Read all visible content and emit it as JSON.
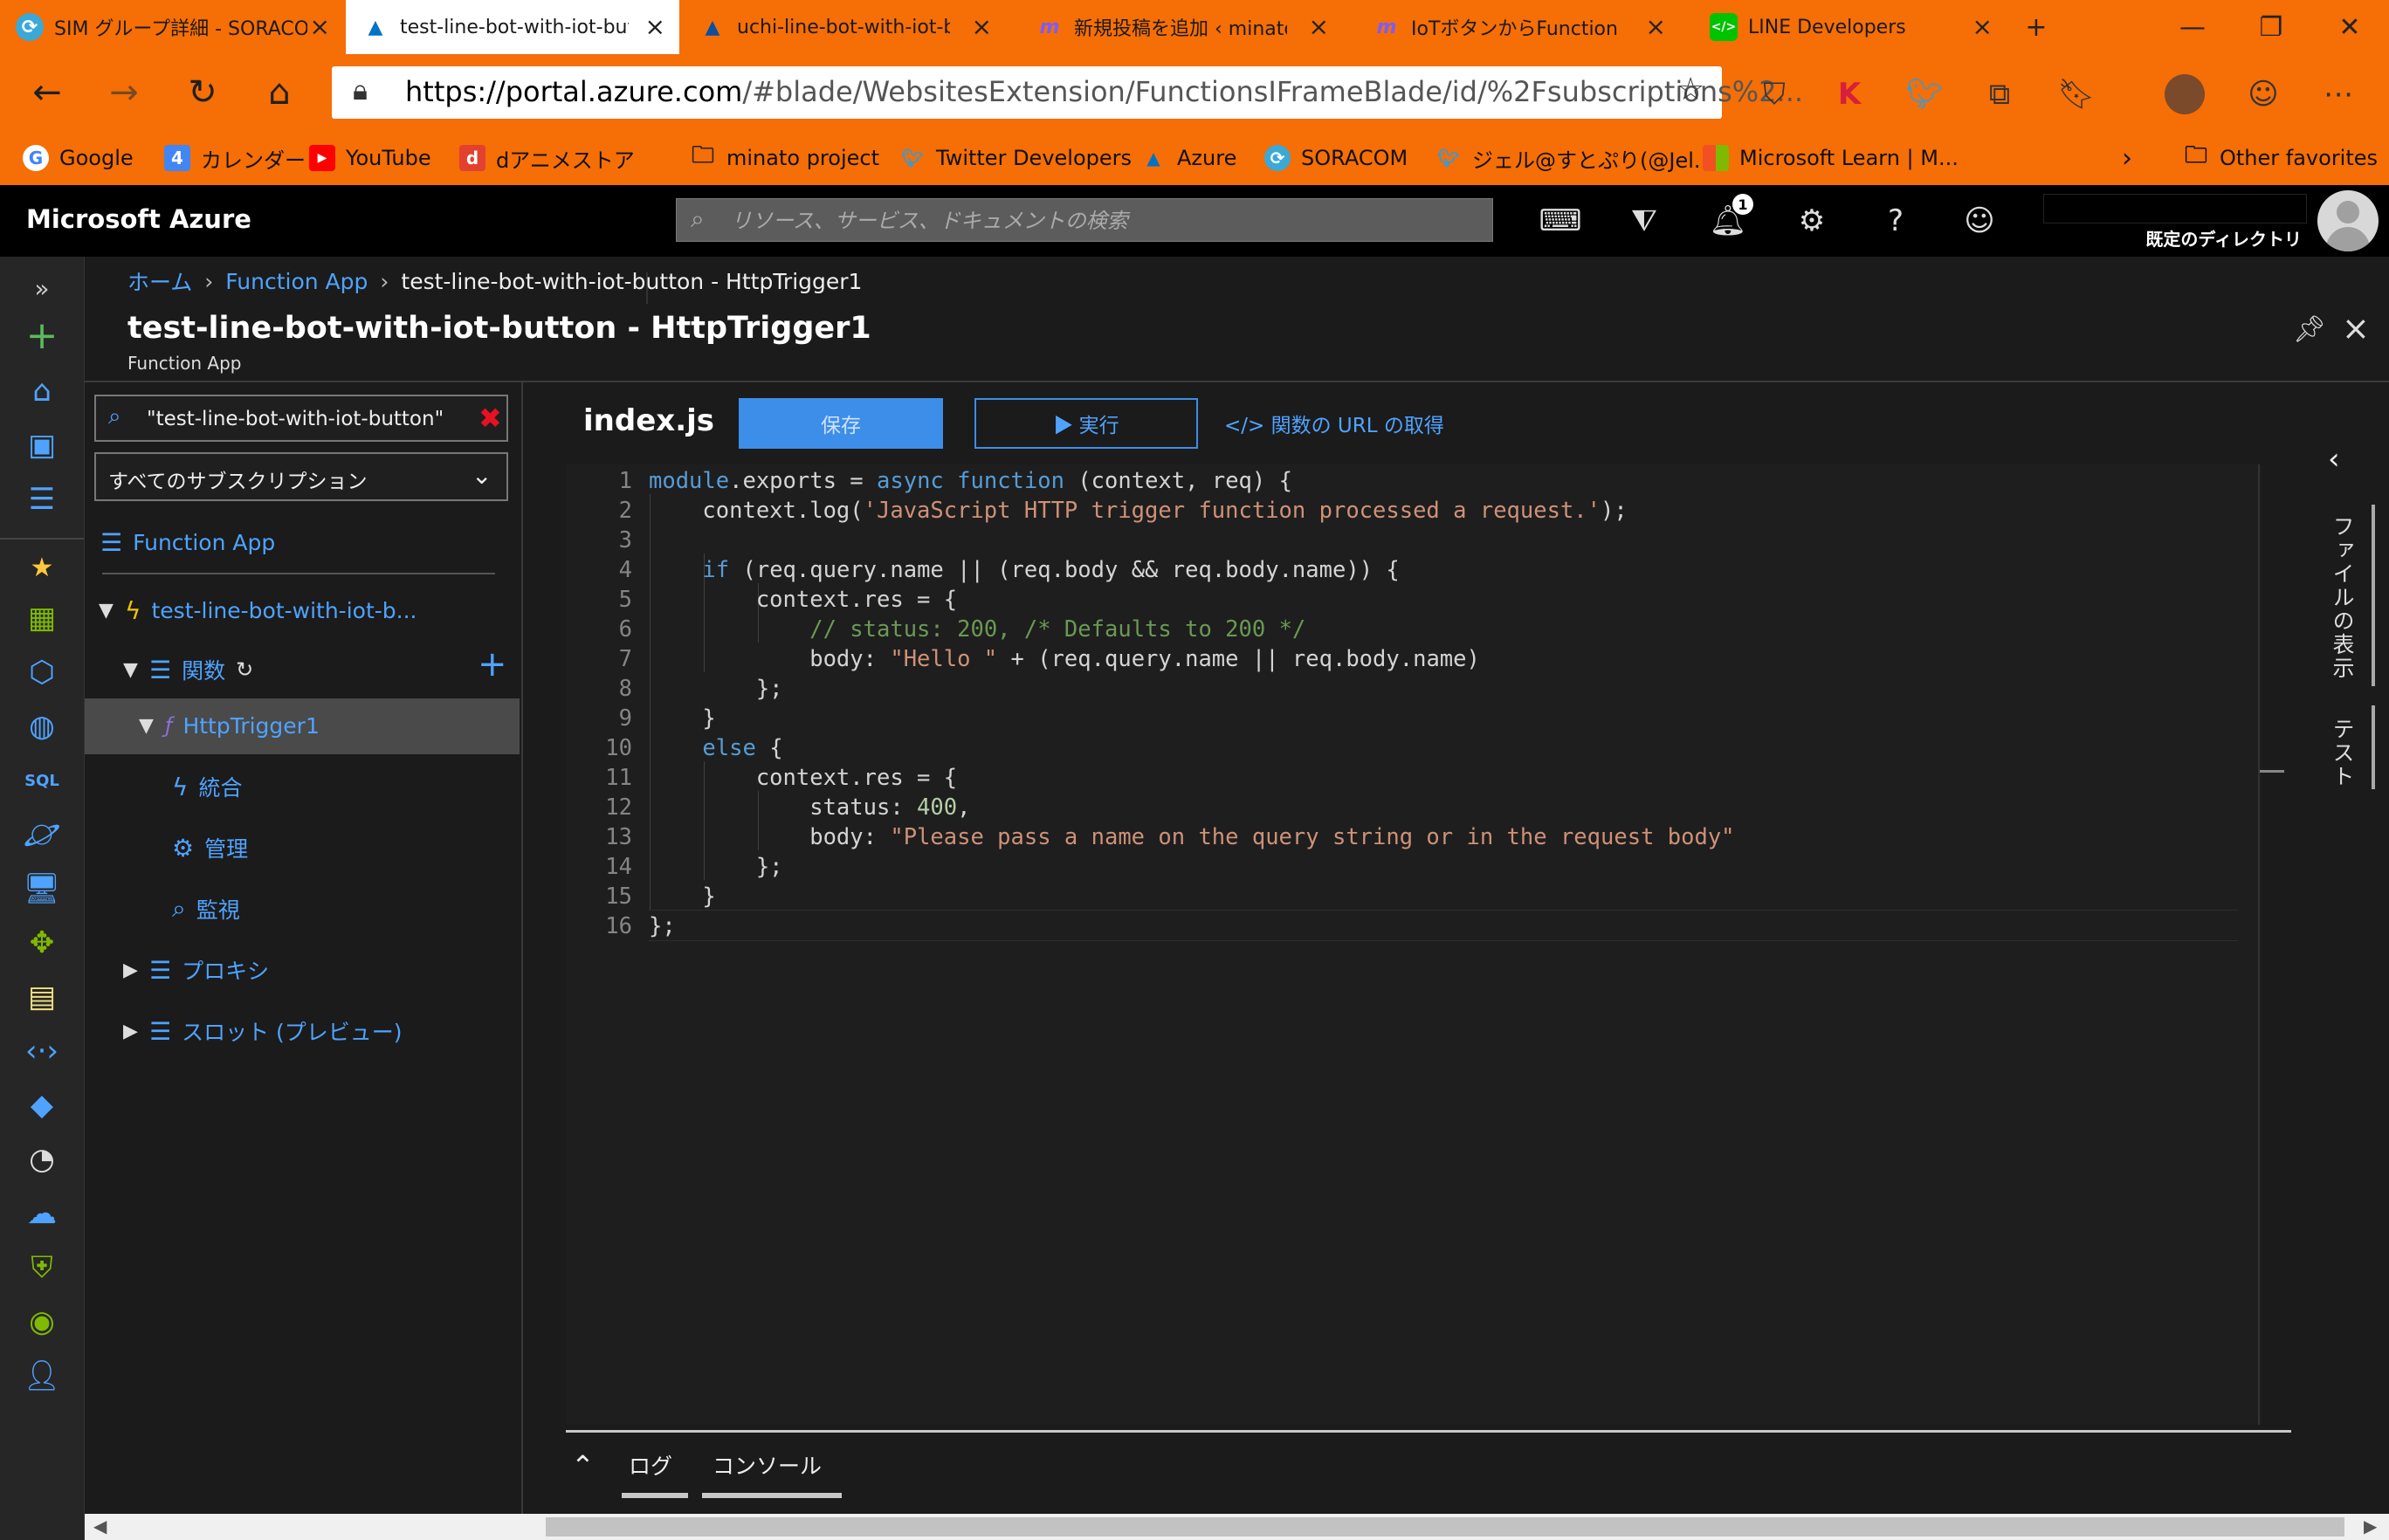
{
  "browser": {
    "tabs": [
      {
        "label": "SIM グループ詳細 - SORACOM",
        "icon": "soracom-icon",
        "icon_color": "#3aa9d8"
      },
      {
        "label": "test-line-bot-with-iot-button",
        "icon": "azure-icon",
        "icon_color": "#0072c6"
      },
      {
        "label": "uchi-line-bot-with-iot-button",
        "icon": "azure-icon",
        "icon_color": "#0072c6"
      },
      {
        "label": "新規投稿を追加 ‹ minato",
        "icon": "wordpress-m-icon",
        "icon_color": "#7b5cff"
      },
      {
        "label": "IoTボタンからFunction App",
        "icon": "wordpress-m-icon",
        "icon_color": "#7b5cff"
      },
      {
        "label": "LINE Developers",
        "icon": "line-icon",
        "icon_color": "#00c300"
      }
    ],
    "url_host": "https://portal.azure.com",
    "url_rest": "/#blade/WebsitesExtension/FunctionsIFrameBlade/id/%2Fsubscriptions%2...",
    "favorites": [
      {
        "label": "Google",
        "icon": "google-icon",
        "color": "#4285f4"
      },
      {
        "label": "カレンダー",
        "icon": "calendar-icon",
        "color": "#4285f4"
      },
      {
        "label": "YouTube",
        "icon": "youtube-icon",
        "color": "#ff0000"
      },
      {
        "label": "dアニメストア",
        "icon": "danime-icon",
        "color": "#e2412f"
      },
      {
        "label": "minato project",
        "icon": "folder-icon",
        "color": "#333333"
      },
      {
        "label": "Twitter Developers",
        "icon": "twitter-icon",
        "color": "#1da1f2"
      },
      {
        "label": "Azure",
        "icon": "azure-icon",
        "color": "#0072c6"
      },
      {
        "label": "SORACOM",
        "icon": "soracom-icon",
        "color": "#3aa9d8"
      },
      {
        "label": "ジェル@すとぷり(@Jel...",
        "icon": "twitter-icon",
        "color": "#1da1f2"
      },
      {
        "label": "Microsoft Learn | M...",
        "icon": "microsoft-icon",
        "color": "#f25022"
      }
    ],
    "other_favorites": "Other favorites"
  },
  "azure": {
    "brand": "Microsoft Azure",
    "search_placeholder": "リソース、サービス、ドキュメントの検索",
    "notification_count": "1",
    "directory_label": "既定のディレクトリ",
    "accent": "#3d8ee8"
  },
  "breadcrumb": {
    "home": "ホーム",
    "function_app": "Function App",
    "current": "test-line-bot-with-iot-button - HttpTrigger1"
  },
  "blade": {
    "title": "test-line-bot-with-iot-button - HttpTrigger1",
    "subtitle": "Function App"
  },
  "tree": {
    "filter_value": "\"test-line-bot-with-iot-button\"",
    "subscription": "すべてのサブスクリプション",
    "root": "Function App",
    "app": "test-line-bot-with-iot-b...",
    "functions": "関数",
    "trigger": "HttpTrigger1",
    "integrate": "統合",
    "manage": "管理",
    "monitor": "監視",
    "proxies": "プロキシ",
    "slots": "スロット (プレビュー)"
  },
  "editor": {
    "filename": "index.js",
    "save_label": "保存",
    "run_label": "▶ 実行",
    "get_url_label": "</> 関数の URL の取得",
    "code_lines": [
      "module.exports = async function (context, req) {",
      "    context.log('JavaScript HTTP trigger function processed a request.');",
      "",
      "    if (req.query.name || (req.body && req.body.name)) {",
      "        context.res = {",
      "            // status: 200, /* Defaults to 200 */",
      "            body: \"Hello \" + (req.query.name || req.body.name)",
      "        };",
      "    }",
      "    else {",
      "        context.res = {",
      "            status: 400,",
      "            body: \"Please pass a name on the query string or in the request body\"",
      "        };",
      "    }",
      "};"
    ]
  },
  "log_panel": {
    "log_tab": "ログ",
    "console_tab": "コンソール"
  },
  "side_tabs": {
    "files": "ファイルの表示",
    "test": "テスト"
  }
}
